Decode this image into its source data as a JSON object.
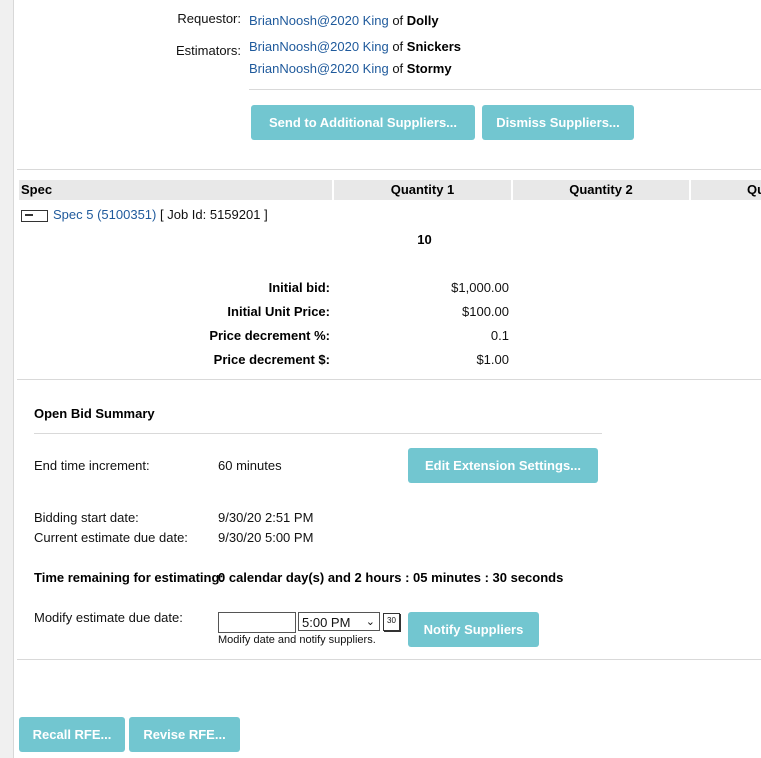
{
  "requestor": {
    "label": "Requestor:",
    "name": "BrianNoosh@2020 King",
    "of": "of",
    "company": "Dolly"
  },
  "estimators": {
    "label": "Estimators:",
    "items": [
      {
        "name": "BrianNoosh@2020 King",
        "of": "of",
        "company": "Snickers"
      },
      {
        "name": "BrianNoosh@2020 King",
        "of": "of",
        "company": "Stormy"
      }
    ]
  },
  "supplier_buttons": {
    "send": "Send to Additional Suppliers...",
    "dismiss": "Dismiss Suppliers..."
  },
  "table": {
    "headers": [
      "Spec",
      "Quantity 1",
      "Quantity 2",
      "Qu"
    ],
    "spec_link": "Spec 5 (5100351)",
    "job_id": "[ Job Id: 5159201 ]",
    "quantity1": "10",
    "rows": [
      {
        "label": "Initial bid:",
        "value": "$1,000.00"
      },
      {
        "label": "Initial Unit Price:",
        "value": "$100.00"
      },
      {
        "label": "Price decrement %:",
        "value": "0.1"
      },
      {
        "label": "Price decrement $:",
        "value": "$1.00"
      }
    ]
  },
  "open_bid": {
    "title": "Open Bid Summary",
    "end_time_label": "End time increment:",
    "end_time_value": "60 minutes",
    "edit_button": "Edit Extension Settings...",
    "start_label": "Bidding start date:",
    "start_value": "9/30/20 2:51 PM",
    "due_label": "Current estimate due date:",
    "due_value": "9/30/20 5:00 PM",
    "remaining_label": "Time remaining for estimating:",
    "remaining_value": "0 calendar day(s) and 2 hours : 05 minutes : 30 seconds",
    "modify_label": "Modify estimate due date:",
    "date_value": "",
    "time_value": "5:00 PM",
    "calendar_label": "30",
    "helper": "Modify date and notify suppliers.",
    "notify_button": "Notify Suppliers"
  },
  "footer_buttons": {
    "recall": "Recall RFE...",
    "revise": "Revise RFE..."
  },
  "colors": {
    "button": "#72c6d0",
    "link": "#1f5a9c"
  }
}
